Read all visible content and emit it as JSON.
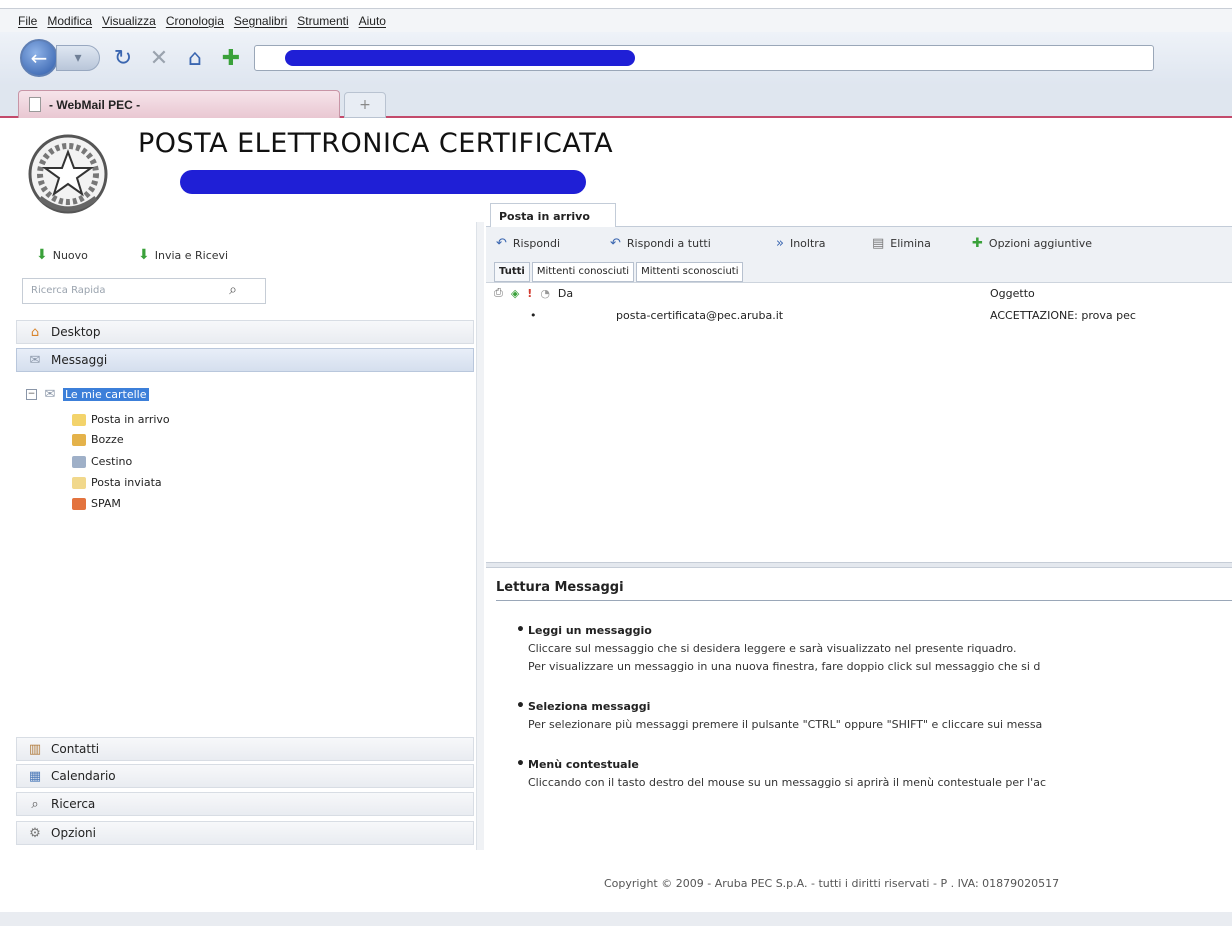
{
  "menubar": {
    "items": [
      "File",
      "Modifica",
      "Visualizza",
      "Cronologia",
      "Segnalibri",
      "Strumenti",
      "Aiuto"
    ]
  },
  "browser": {
    "tab_title": "- WebMail PEC -",
    "new_tab_label": "+"
  },
  "header": {
    "title": "POSTA ELETTRONICA CERTIFICATA"
  },
  "left": {
    "new_label": "Nuovo",
    "send_receive_label": "Invia e Ricevi",
    "search_placeholder": "Ricerca Rapida",
    "sections": {
      "desktop": "Desktop",
      "messaggi": "Messaggi",
      "contatti": "Contatti",
      "calendario": "Calendario",
      "ricerca": "Ricerca",
      "opzioni": "Opzioni"
    },
    "tree": {
      "root": "Le mie cartelle",
      "folders": [
        "Posta in arrivo",
        "Bozze",
        "Cestino",
        "Posta inviata",
        "SPAM"
      ]
    }
  },
  "inbox": {
    "tab_label": "Posta in arrivo",
    "toolbar": {
      "reply": "Rispondi",
      "reply_all": "Rispondi a tutti",
      "forward": "Inoltra",
      "delete": "Elimina",
      "more": "Opzioni aggiuntive"
    },
    "filters": [
      "Tutti",
      "Mittenti conosciuti",
      "Mittenti sconosciuti"
    ],
    "columns": {
      "from": "Da",
      "subject": "Oggetto"
    },
    "rows": [
      {
        "bullet": "•",
        "from": "posta-certificata@pec.aruba.it",
        "subject": "ACCETTAZIONE: prova pec"
      }
    ]
  },
  "reading": {
    "title": "Lettura Messaggi",
    "sections": [
      {
        "heading": "Leggi un messaggio",
        "lines": [
          "Cliccare sul messaggio che si desidera leggere e sarà visualizzato nel presente riquadro.",
          "Per visualizzare un messaggio in una nuova finestra, fare doppio click sul messaggio che si d"
        ]
      },
      {
        "heading": "Seleziona messaggi",
        "lines": [
          "Per selezionare più messaggi premere il pulsante \"CTRL\" oppure \"SHIFT\" e cliccare sui messa"
        ]
      },
      {
        "heading": "Menù contestuale",
        "lines": [
          "Cliccando con il tasto destro del mouse su un messaggio si aprirà il menù contestuale per l'ac"
        ]
      }
    ]
  },
  "footer": {
    "copyright": "Copyright © 2009 - Aruba PEC S.p.A. - tutti i diritti riservati - P . IVA: 01879020517"
  },
  "colors": {
    "tab_accent": "#c34a6b",
    "selection": "#3c7fd9",
    "redaction": "#1f1fd6",
    "action_green": "#3aa13a"
  }
}
